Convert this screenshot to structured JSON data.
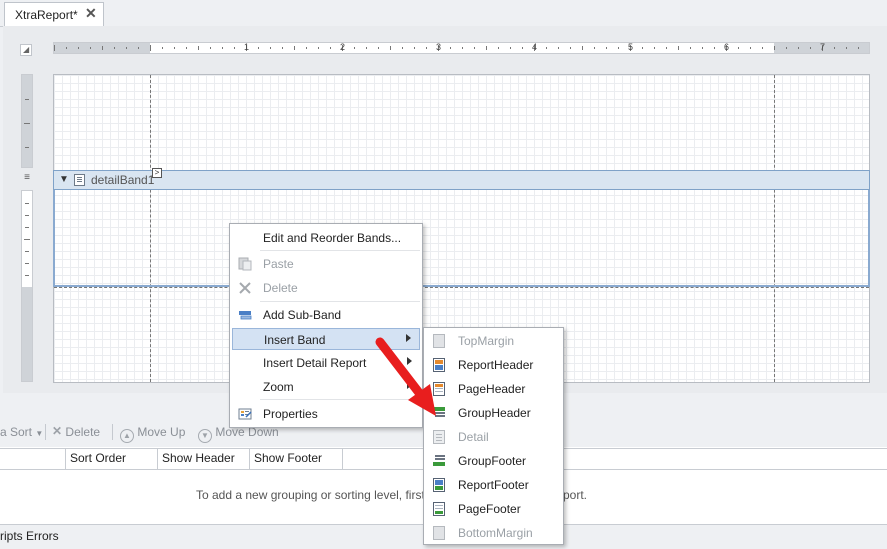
{
  "tab": {
    "title": "XtraReport*",
    "close": "✕"
  },
  "ruler": {
    "corner": "◢",
    "numbers": [
      "1",
      "2",
      "3",
      "4",
      "5",
      "6",
      "7"
    ]
  },
  "band": {
    "collapse": "▼",
    "label": "detailBand1",
    "smart_tag": ">"
  },
  "context_menu": {
    "items": [
      {
        "label": "Edit and Reorder Bands...",
        "icon": "none",
        "enabled": true
      },
      {
        "label": "Paste",
        "icon": "paste-icon",
        "enabled": false
      },
      {
        "label": "Delete",
        "icon": "delete-x-icon",
        "enabled": false
      },
      {
        "label": "Add Sub-Band",
        "icon": "add-subband-icon",
        "enabled": true
      },
      {
        "label": "Insert Band",
        "icon": "none",
        "enabled": true,
        "submenu": true,
        "highlighted": true
      },
      {
        "label": "Insert Detail Report",
        "icon": "none",
        "enabled": true,
        "submenu": true
      },
      {
        "label": "Zoom",
        "icon": "none",
        "enabled": true,
        "submenu": true
      },
      {
        "label": "Properties",
        "icon": "properties-icon",
        "enabled": true
      }
    ]
  },
  "insert_band_menu": {
    "items": [
      {
        "label": "TopMargin",
        "enabled": false
      },
      {
        "label": "ReportHeader",
        "enabled": true
      },
      {
        "label": "PageHeader",
        "enabled": true
      },
      {
        "label": "GroupHeader",
        "enabled": true
      },
      {
        "label": "Detail",
        "enabled": false
      },
      {
        "label": "GroupFooter",
        "enabled": true
      },
      {
        "label": "ReportFooter",
        "enabled": true
      },
      {
        "label": "PageFooter",
        "enabled": true
      },
      {
        "label": "BottomMargin",
        "enabled": false
      }
    ]
  },
  "group_sort": {
    "toolbar": {
      "sort": "a Sort",
      "delete": "Delete",
      "move_up": "Move Up",
      "move_down": "Move Down"
    },
    "columns": [
      "Sort Order",
      "Show Header",
      "Show Footer"
    ],
    "hint": "To add a new grouping or sorting level, first pro",
    "hint_tail": "port."
  },
  "status": {
    "tab": "ripts Errors"
  },
  "colors": {
    "highlight": "#d4e2f3",
    "band_header": "#d9e5f1",
    "arrow": "#e81e1e"
  }
}
